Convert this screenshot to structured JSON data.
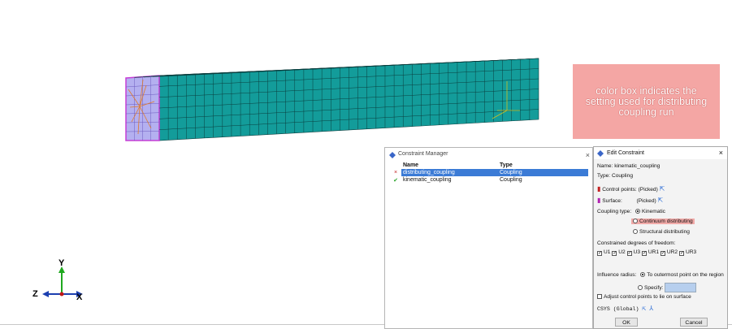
{
  "annotation": {
    "text": "color box indicates the setting used for distributing coupling run"
  },
  "triad": {
    "y": "Y",
    "z": "Z",
    "x": "X"
  },
  "constraint_manager": {
    "title": "Constraint Manager",
    "close": "×",
    "columns": [
      "Name",
      "Type"
    ],
    "rows": [
      {
        "status": "×",
        "name": "distributing_coupling",
        "type": "Coupling",
        "selected": true
      },
      {
        "status": "✔",
        "name": "kinematic_coupling",
        "type": "Coupling",
        "selected": false
      }
    ]
  },
  "edit_constraint": {
    "title": "Edit Constraint",
    "close": "×",
    "name_line": "Name:  kinematic_coupling",
    "type_line": "Type:   Coupling",
    "control_points": "Control points:  (Picked)",
    "surface_label": "Surface:",
    "surface_value": "(Picked)",
    "coupling_type_label": "Coupling type:",
    "coupling_options": [
      "Kinematic",
      "Continuum distributing",
      "Structural distributing"
    ],
    "dof_label": "Constrained degrees of freedom:",
    "dofs": [
      "U1",
      "U2",
      "U3",
      "UR1",
      "UR2",
      "UR3"
    ],
    "influence_label": "Influence radius:",
    "influence_opt1": "To outermost point on the region",
    "influence_opt2": "Specify:",
    "adjust_label": "Adjust control points to lie on surface",
    "csys": "CSYS (Global)",
    "ok": "OK",
    "cancel": "Cancel"
  },
  "colors": {
    "mesh": "#139c9a",
    "mesh_line": "#0a3f3f",
    "end_face": "#b4b0f0",
    "highlight": "#f4a6a4",
    "selection": "#3b7bd6"
  }
}
